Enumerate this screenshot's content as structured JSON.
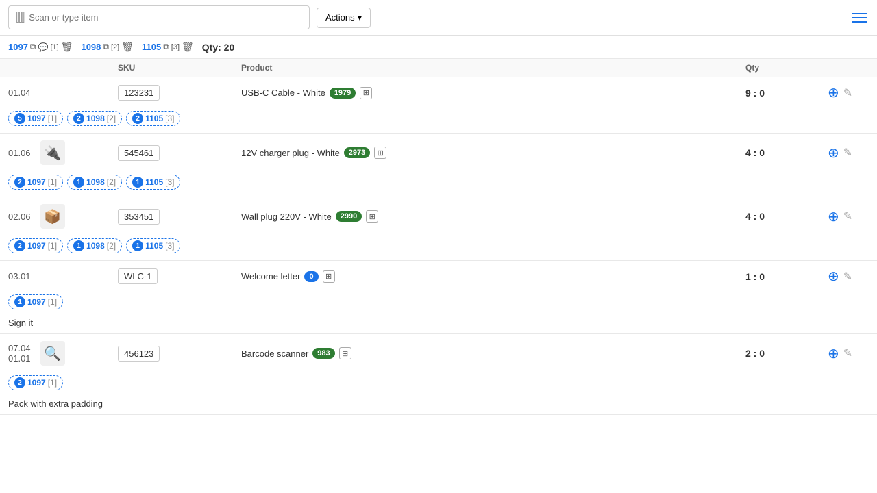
{
  "topbar": {
    "scan_placeholder": "Scan or type item",
    "actions_label": "Actions",
    "total_qty_label": "Qty: 20"
  },
  "order_tabs": [
    {
      "id": "1097",
      "icon": "copy",
      "count": null,
      "chat_count": "1",
      "delete": true
    },
    {
      "id": "1098",
      "count": "2",
      "delete": true
    },
    {
      "id": "1105",
      "count": "3",
      "delete": true
    }
  ],
  "table": {
    "headers": [
      "",
      "SKU",
      "Product",
      "Qty",
      ""
    ],
    "rows": [
      {
        "location": "01.04",
        "has_thumb": false,
        "sku": "123231",
        "product_name": "USB-C Cable - White",
        "badge": "1979",
        "qty": "9 : 0",
        "tags": [
          {
            "num": "5",
            "id": "1097",
            "count": "1"
          },
          {
            "num": "2",
            "id": "1098",
            "count": "2"
          },
          {
            "num": "2",
            "id": "1105",
            "count": "3"
          }
        ],
        "note": null
      },
      {
        "location": "01.06",
        "has_thumb": true,
        "thumb_icon": "🔌",
        "sku": "545461",
        "product_name": "12V charger plug - White",
        "badge": "2973",
        "qty": "4 : 0",
        "tags": [
          {
            "num": "2",
            "id": "1097",
            "count": "1"
          },
          {
            "num": "1",
            "id": "1098",
            "count": "2"
          },
          {
            "num": "1",
            "id": "1105",
            "count": "3"
          }
        ],
        "note": null
      },
      {
        "location": "02.06",
        "has_thumb": true,
        "thumb_icon": "📦",
        "sku": "353451",
        "product_name": "Wall plug 220V - White",
        "badge": "2990",
        "qty": "4 : 0",
        "tags": [
          {
            "num": "2",
            "id": "1097",
            "count": "1"
          },
          {
            "num": "1",
            "id": "1098",
            "count": "2"
          },
          {
            "num": "1",
            "id": "1105",
            "count": "3"
          }
        ],
        "note": null
      },
      {
        "location": "03.01",
        "has_thumb": false,
        "sku": "WLC-1",
        "product_name": "Welcome letter",
        "badge": "0",
        "badge_color": "#1a73e8",
        "qty": "1 : 0",
        "tags": [
          {
            "num": "1",
            "id": "1097",
            "count": "1"
          }
        ],
        "note": "Sign it"
      },
      {
        "location_multi": [
          "07.04",
          "01.01"
        ],
        "has_thumb": true,
        "thumb_icon": "🔍",
        "sku": "456123",
        "product_name": "Barcode scanner",
        "badge": "983",
        "qty": "2 : 0",
        "tags": [
          {
            "num": "2",
            "id": "1097",
            "count": "1"
          }
        ],
        "note": "Pack with extra padding"
      }
    ]
  },
  "icons": {
    "barcode": "|||",
    "chevron_down": "▾",
    "hamburger": "≡",
    "plus": "+",
    "pencil": "✎",
    "copy": "⧉",
    "chat": "💬",
    "trash": "🗑",
    "expand": "⊞"
  }
}
